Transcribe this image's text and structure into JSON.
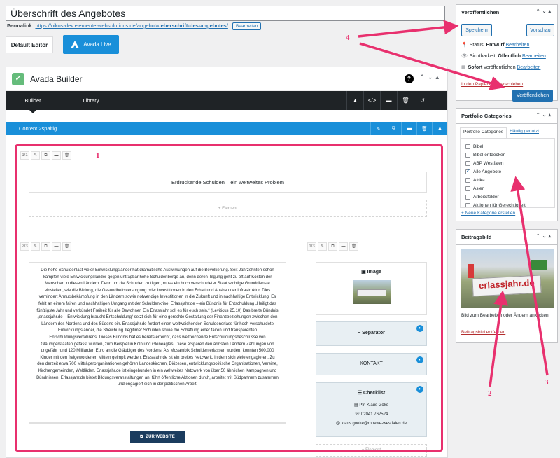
{
  "title_input": {
    "value": "Überschrift des Angebotes"
  },
  "permalink": {
    "label": "Permalink:",
    "url": "https://oikos-dev.elemente-websolutions.de/angebot/",
    "slug": "ueberschrift-des-angebotes/",
    "edit": "Bearbeiten"
  },
  "editor_buttons": {
    "default_editor": "Default Editor",
    "avada_live": "Avada Live"
  },
  "builder": {
    "title": "Avada Builder",
    "help": "?",
    "tabs": [
      "Builder",
      "Library"
    ],
    "container_label": "Content 2spaltig",
    "row1": {
      "column_label": "1/1",
      "element_title": "Erdrückende Schulden – ein weltweites Problem",
      "add_element": "+ Element"
    },
    "col_left": {
      "column_label": "2/3",
      "text": "Die hohe Schuldenlast vieler Entwicklungsländer hat dramatische Auswirkungen auf die Bevölkerung. Seit Jahrzehnten schon kämpfen viele Entwicklungsländer gegen untragbar hohe Schuldenberge an, denn deren Tilgung geht zu oft auf Kosten der Menschen in diesen Ländern. Denn um die Schulden zu tilgen, muss ein hoch verschuldeter Staat wichtige Grunddienste einstellen, wie die Bildung, die Gesundheitsversorgung oder Investitionen in den Erhalt und Ausbau der Infrastruktur. Dies verhindert Armutsbekämpfung in den Ländern sowie notwendige Investitionen in die Zukunft und in nachhaltige Entwicklung. Es fehlt an einem fairen und nachhaltigen Umgang mit der Schuldenkrise. Erlassjahr.de – ein Bündnis für Entschuldung „Heiligt das fünfzigste Jahr und verkündet Freiheit für alle Bewohner. Ein Erlassjahr soll es für euch sein.“ (Leviticus 25,10) Das breite Bündnis „erlassjahr.de – Entwicklung braucht Entschuldung“ setzt sich für eine gerechte Gestaltung der Finanzbeziehungen zwischen den Ländern des Nordens und des Südens ein. Erlassjahr.de fordert einen weltweichenden Schuldenerlass für hoch verschuldete Entwicklungsländer, die Streichung illegitimer Schulden sowie die Schaffung einer fairen und transparenten Entschuldungsverfahrens. Dieses Bündnis hat es bereits erreicht, dass weitreichende Entschuldungsbeschlüsse von Gläubigerstaaten gefasst wurden, zum Beispiel in Köln und Gleneagles. Diese ersparen den ärmsten Ländern Zahlungen von ungefähr rund 120 Milliarden Euro an die Gläubiger des Nordens. Als Mosambik Schulden erlassen wurden, konnten 500.000 Kinder mit den freigewordenen Mitteln geimpft werden. Erlassjahr.de ist ein breites Netzwerk, in dem sich viele engagieren. Zu den derzeit etwa 700 Mitträgerorganisationen gehören Landeskirchen, Diözesen, entwicklungspolitische Organisationen, Vereine, Kirchengemeinden, Weltläden. Erlassjahr.de ist eingebunden in ein weltweites Netzwerk von über 50 ähnlichen Kampagnen und Bündnissen. Erlassjahr.de bietet Bildungsveranstaltungen an, führt öffentliche Aktionen durch, arbeitet mit Südpartnern zusammen und engagiert sich in der politischen Arbeit.",
      "button": "ZUR WEBSITE"
    },
    "col_right": {
      "column_label": "1/3",
      "image_label": "Image",
      "separator_label": "Separator",
      "kontakt_label": "KONTAKT",
      "checklist_label": "Checklist",
      "checklist_items": [
        "Pfr. Klaus Göke",
        "02041 762524",
        "klaus.goeke@moewe-westfalen.de"
      ],
      "add_element": "+ Element"
    }
  },
  "annotations": [
    "1",
    "2",
    "3",
    "4"
  ],
  "publish_box": {
    "title": "Veröffentlichen",
    "save": "Speichern",
    "preview": "Vorschau",
    "status_label": "Status:",
    "status_value": "Entwurf",
    "status_edit": "Bearbeiten",
    "visibility_label": "Sichtbarkeit:",
    "visibility_value": "Öffentlich",
    "visibility_edit": "Bearbeiten",
    "publish_label": "Sofort",
    "publish_text": "veröffentlichen",
    "publish_edit": "Bearbeiten",
    "trash": "In den Papierkorb verschieben",
    "publish": "Veröffentlichen"
  },
  "categories_box": {
    "title": "Portfolio Categories",
    "tabs": [
      "Portfolio Categories",
      "Häufig genutzt"
    ],
    "items": [
      {
        "label": "Bibel",
        "checked": false
      },
      {
        "label": "Bibel entdecken",
        "checked": false
      },
      {
        "label": "ABP Westfalen",
        "checked": false
      },
      {
        "label": "Alle Angebote",
        "checked": true
      },
      {
        "label": "Afrika",
        "checked": false
      },
      {
        "label": "Asien",
        "checked": false
      },
      {
        "label": "Arbeitsfelder",
        "checked": false
      },
      {
        "label": "Aktionen für Gerechtigkeit",
        "checked": false
      }
    ],
    "add": "+ Neue Kategorie erstellen"
  },
  "featured_box": {
    "title": "Beitragsbild",
    "banner_text": "erlassjahr.de",
    "help": "Bild zum Bearbeiten oder Ändern anklicken",
    "remove": "Beitragsbild entfernen"
  },
  "colors": {
    "accent": "#198fd9",
    "annotation": "#e8306e",
    "wp_blue": "#2271b1",
    "dark_bar": "#1f2326"
  }
}
